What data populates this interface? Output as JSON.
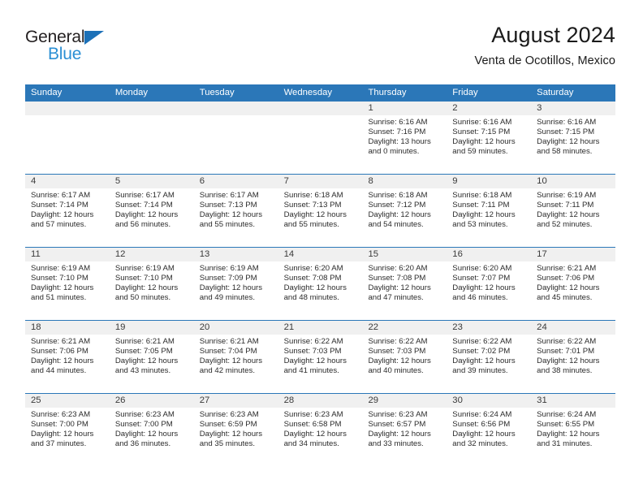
{
  "logo": {
    "text_top": "General",
    "text_bottom": "Blue",
    "triangle_color": "#1d71b8",
    "blue_color": "#2b8fd4"
  },
  "header": {
    "title": "August 2024",
    "subtitle": "Venta de Ocotillos, Mexico"
  },
  "theme": {
    "header_blue": "#2b77b8",
    "day_band_gray": "#f0f0f0",
    "text_color": "#2b2b2b"
  },
  "weekdays": [
    "Sunday",
    "Monday",
    "Tuesday",
    "Wednesday",
    "Thursday",
    "Friday",
    "Saturday"
  ],
  "weeks": [
    [
      {
        "day": "",
        "lines": []
      },
      {
        "day": "",
        "lines": []
      },
      {
        "day": "",
        "lines": []
      },
      {
        "day": "",
        "lines": []
      },
      {
        "day": "1",
        "lines": [
          "Sunrise: 6:16 AM",
          "Sunset: 7:16 PM",
          "Daylight: 13 hours",
          "and 0 minutes."
        ]
      },
      {
        "day": "2",
        "lines": [
          "Sunrise: 6:16 AM",
          "Sunset: 7:15 PM",
          "Daylight: 12 hours",
          "and 59 minutes."
        ]
      },
      {
        "day": "3",
        "lines": [
          "Sunrise: 6:16 AM",
          "Sunset: 7:15 PM",
          "Daylight: 12 hours",
          "and 58 minutes."
        ]
      }
    ],
    [
      {
        "day": "4",
        "lines": [
          "Sunrise: 6:17 AM",
          "Sunset: 7:14 PM",
          "Daylight: 12 hours",
          "and 57 minutes."
        ]
      },
      {
        "day": "5",
        "lines": [
          "Sunrise: 6:17 AM",
          "Sunset: 7:14 PM",
          "Daylight: 12 hours",
          "and 56 minutes."
        ]
      },
      {
        "day": "6",
        "lines": [
          "Sunrise: 6:17 AM",
          "Sunset: 7:13 PM",
          "Daylight: 12 hours",
          "and 55 minutes."
        ]
      },
      {
        "day": "7",
        "lines": [
          "Sunrise: 6:18 AM",
          "Sunset: 7:13 PM",
          "Daylight: 12 hours",
          "and 55 minutes."
        ]
      },
      {
        "day": "8",
        "lines": [
          "Sunrise: 6:18 AM",
          "Sunset: 7:12 PM",
          "Daylight: 12 hours",
          "and 54 minutes."
        ]
      },
      {
        "day": "9",
        "lines": [
          "Sunrise: 6:18 AM",
          "Sunset: 7:11 PM",
          "Daylight: 12 hours",
          "and 53 minutes."
        ]
      },
      {
        "day": "10",
        "lines": [
          "Sunrise: 6:19 AM",
          "Sunset: 7:11 PM",
          "Daylight: 12 hours",
          "and 52 minutes."
        ]
      }
    ],
    [
      {
        "day": "11",
        "lines": [
          "Sunrise: 6:19 AM",
          "Sunset: 7:10 PM",
          "Daylight: 12 hours",
          "and 51 minutes."
        ]
      },
      {
        "day": "12",
        "lines": [
          "Sunrise: 6:19 AM",
          "Sunset: 7:10 PM",
          "Daylight: 12 hours",
          "and 50 minutes."
        ]
      },
      {
        "day": "13",
        "lines": [
          "Sunrise: 6:19 AM",
          "Sunset: 7:09 PM",
          "Daylight: 12 hours",
          "and 49 minutes."
        ]
      },
      {
        "day": "14",
        "lines": [
          "Sunrise: 6:20 AM",
          "Sunset: 7:08 PM",
          "Daylight: 12 hours",
          "and 48 minutes."
        ]
      },
      {
        "day": "15",
        "lines": [
          "Sunrise: 6:20 AM",
          "Sunset: 7:08 PM",
          "Daylight: 12 hours",
          "and 47 minutes."
        ]
      },
      {
        "day": "16",
        "lines": [
          "Sunrise: 6:20 AM",
          "Sunset: 7:07 PM",
          "Daylight: 12 hours",
          "and 46 minutes."
        ]
      },
      {
        "day": "17",
        "lines": [
          "Sunrise: 6:21 AM",
          "Sunset: 7:06 PM",
          "Daylight: 12 hours",
          "and 45 minutes."
        ]
      }
    ],
    [
      {
        "day": "18",
        "lines": [
          "Sunrise: 6:21 AM",
          "Sunset: 7:06 PM",
          "Daylight: 12 hours",
          "and 44 minutes."
        ]
      },
      {
        "day": "19",
        "lines": [
          "Sunrise: 6:21 AM",
          "Sunset: 7:05 PM",
          "Daylight: 12 hours",
          "and 43 minutes."
        ]
      },
      {
        "day": "20",
        "lines": [
          "Sunrise: 6:21 AM",
          "Sunset: 7:04 PM",
          "Daylight: 12 hours",
          "and 42 minutes."
        ]
      },
      {
        "day": "21",
        "lines": [
          "Sunrise: 6:22 AM",
          "Sunset: 7:03 PM",
          "Daylight: 12 hours",
          "and 41 minutes."
        ]
      },
      {
        "day": "22",
        "lines": [
          "Sunrise: 6:22 AM",
          "Sunset: 7:03 PM",
          "Daylight: 12 hours",
          "and 40 minutes."
        ]
      },
      {
        "day": "23",
        "lines": [
          "Sunrise: 6:22 AM",
          "Sunset: 7:02 PM",
          "Daylight: 12 hours",
          "and 39 minutes."
        ]
      },
      {
        "day": "24",
        "lines": [
          "Sunrise: 6:22 AM",
          "Sunset: 7:01 PM",
          "Daylight: 12 hours",
          "and 38 minutes."
        ]
      }
    ],
    [
      {
        "day": "25",
        "lines": [
          "Sunrise: 6:23 AM",
          "Sunset: 7:00 PM",
          "Daylight: 12 hours",
          "and 37 minutes."
        ]
      },
      {
        "day": "26",
        "lines": [
          "Sunrise: 6:23 AM",
          "Sunset: 7:00 PM",
          "Daylight: 12 hours",
          "and 36 minutes."
        ]
      },
      {
        "day": "27",
        "lines": [
          "Sunrise: 6:23 AM",
          "Sunset: 6:59 PM",
          "Daylight: 12 hours",
          "and 35 minutes."
        ]
      },
      {
        "day": "28",
        "lines": [
          "Sunrise: 6:23 AM",
          "Sunset: 6:58 PM",
          "Daylight: 12 hours",
          "and 34 minutes."
        ]
      },
      {
        "day": "29",
        "lines": [
          "Sunrise: 6:23 AM",
          "Sunset: 6:57 PM",
          "Daylight: 12 hours",
          "and 33 minutes."
        ]
      },
      {
        "day": "30",
        "lines": [
          "Sunrise: 6:24 AM",
          "Sunset: 6:56 PM",
          "Daylight: 12 hours",
          "and 32 minutes."
        ]
      },
      {
        "day": "31",
        "lines": [
          "Sunrise: 6:24 AM",
          "Sunset: 6:55 PM",
          "Daylight: 12 hours",
          "and 31 minutes."
        ]
      }
    ]
  ]
}
